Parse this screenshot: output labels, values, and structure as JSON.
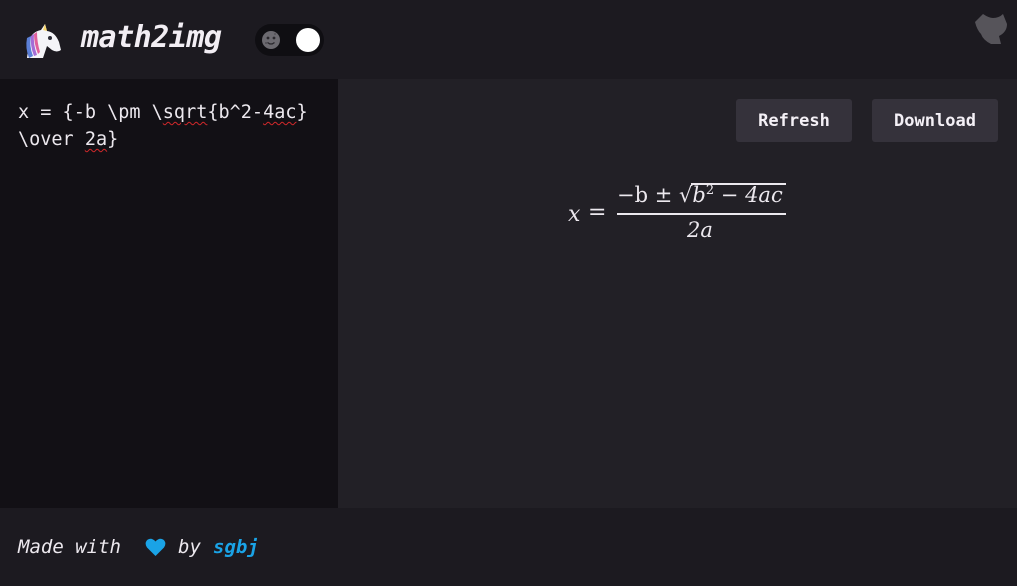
{
  "app": {
    "title": "math2img",
    "logo_icon": "unicorn-icon",
    "theme_toggle": {
      "icon": "moon-face-icon",
      "state": "dark"
    },
    "github_icon": "github-octocat-icon"
  },
  "editor": {
    "value_part1": "x = {-b \\pm \\",
    "value_spell1": "sqrt",
    "value_part2": "{b^2-",
    "value_spell2": "4ac",
    "value_part3": "} \\over ",
    "value_spell3": "2a",
    "value_part4": "}"
  },
  "toolbar": {
    "refresh_label": "Refresh",
    "download_label": "Download"
  },
  "formula": {
    "lhs": "x",
    "eq": "=",
    "num_minus_b": "−b ± ",
    "num_sqrt": "√",
    "num_b": "b",
    "num_exp": "2",
    "num_rest": " − 4ac",
    "den": "2a"
  },
  "footer": {
    "made_with": "Made with",
    "by": "by",
    "author": "sgbj",
    "heart_icon": "heart-icon",
    "heart_color": "#1aa3e6"
  },
  "colors": {
    "background": "#1c1a20",
    "editor_bg": "#121015",
    "preview_bg": "#222026",
    "button_bg": "#35323b",
    "accent": "#1aa3e6"
  }
}
